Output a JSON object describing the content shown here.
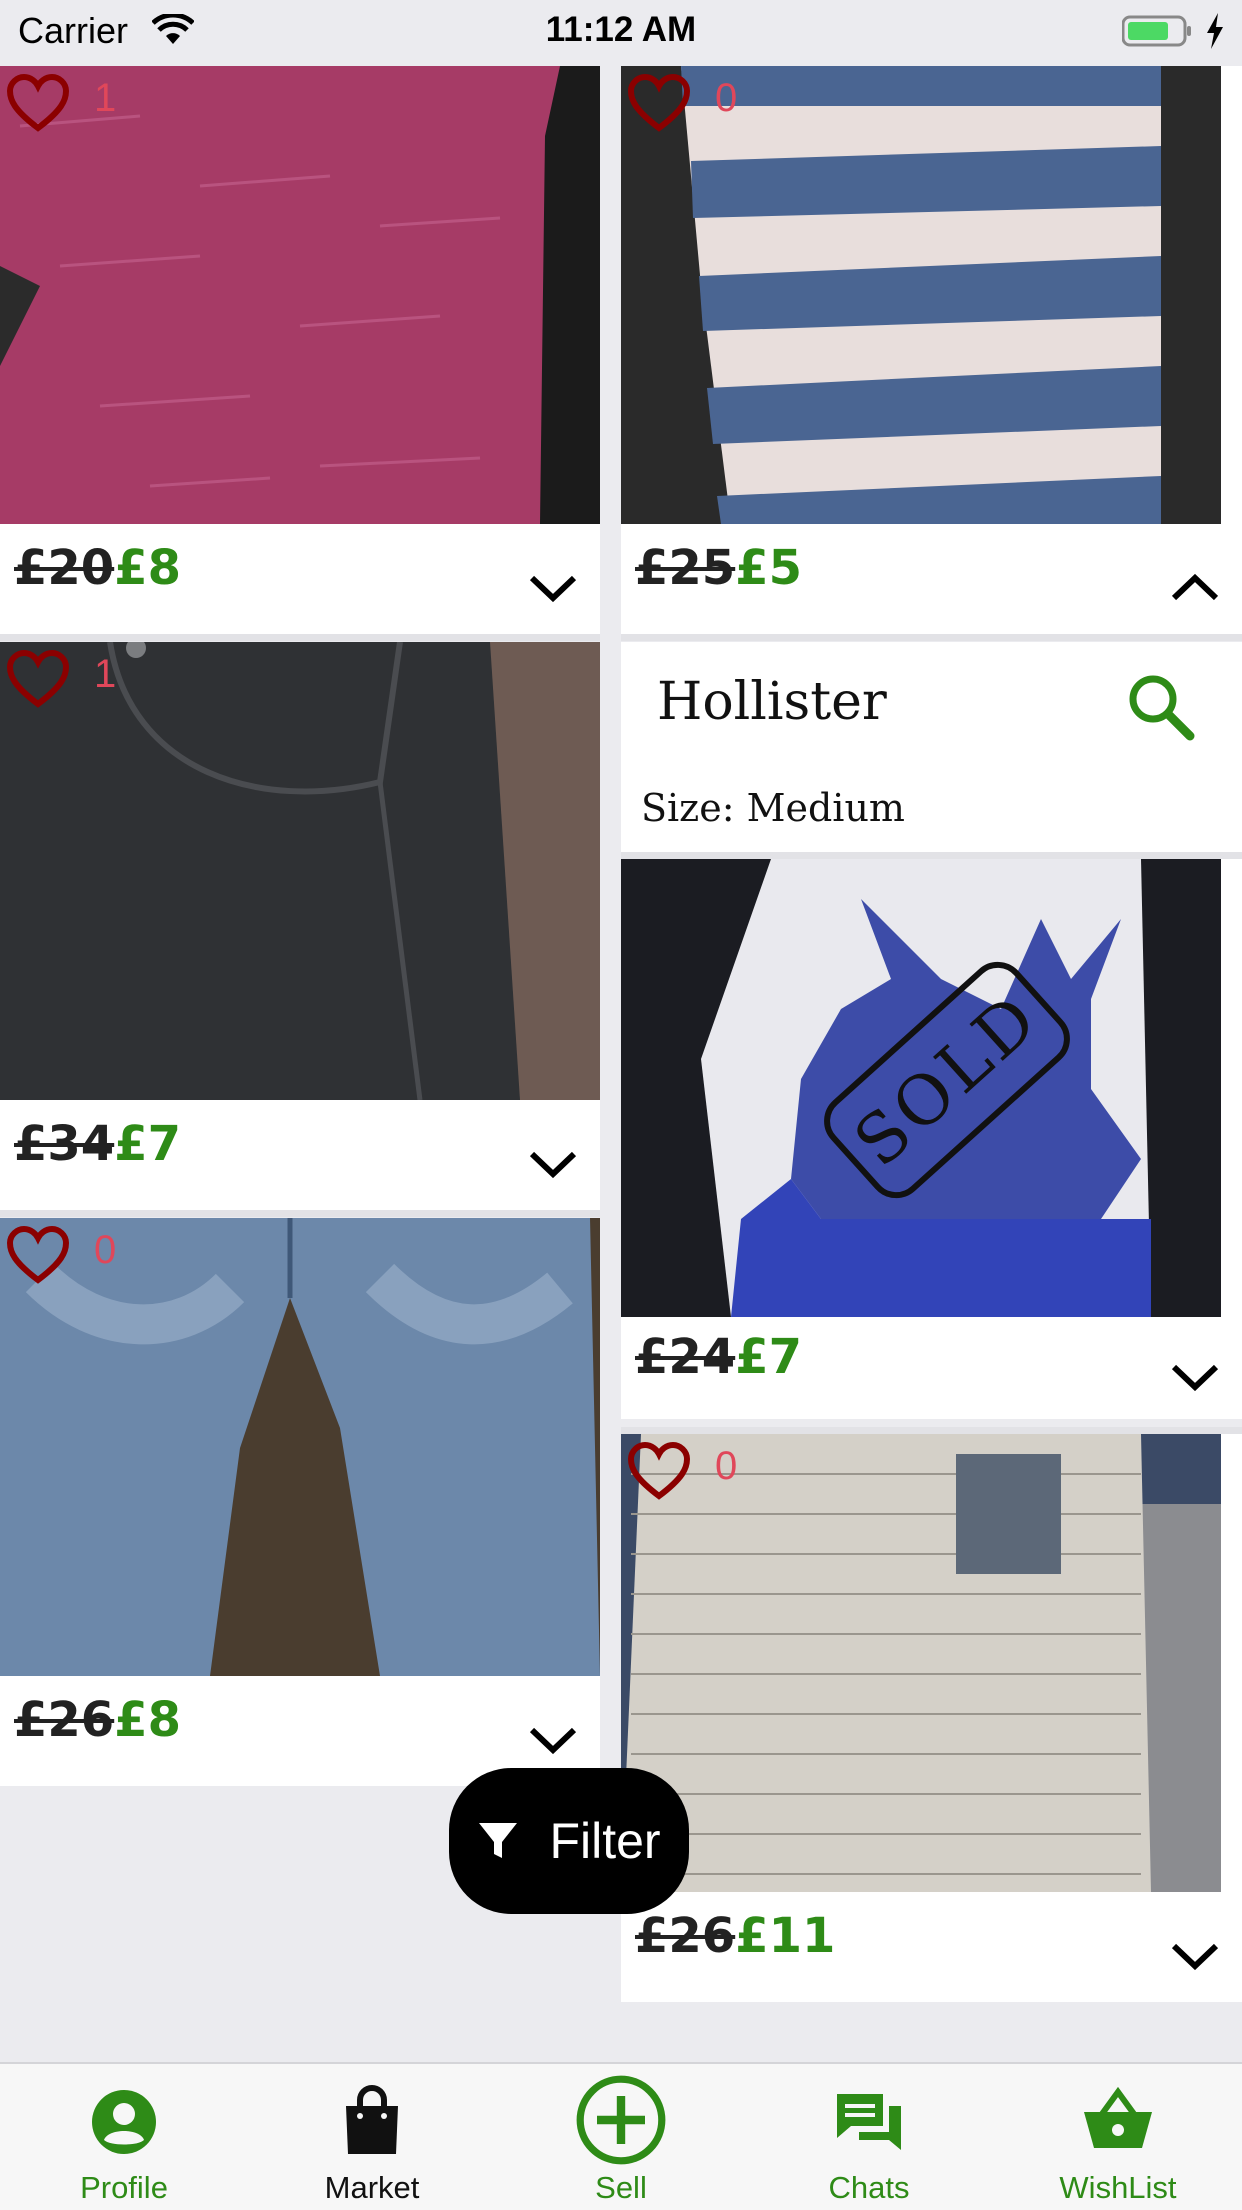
{
  "status_bar": {
    "carrier": "Carrier",
    "time": "11:12 AM"
  },
  "colors": {
    "accent": "#2e8b17",
    "heart": "#8b0000",
    "likes": "#e0475a",
    "background": "#ebebef"
  },
  "items": [
    {
      "likes": "1",
      "old_price": "£20",
      "new_price": "£8",
      "expanded": false,
      "photo": "pink t-shirt"
    },
    {
      "likes": "0",
      "old_price": "£25",
      "new_price": "£5",
      "expanded": true,
      "photo": "blue and white striped t-shirt"
    },
    {
      "likes": "1",
      "old_price": "£34",
      "new_price": "£7",
      "expanded": false,
      "photo": "dark jeans"
    },
    {
      "likes": "0",
      "old_price": "£26",
      "new_price": "£8",
      "expanded": false,
      "photo": "light washed jeans"
    },
    {
      "old_price": "£24",
      "new_price": "£7",
      "expanded": false,
      "photo": "stag print t-shirt",
      "sold_label": "SOLD"
    },
    {
      "likes": "0",
      "old_price": "£26",
      "new_price": "£11",
      "expanded": false,
      "photo": "grey striped t-shirt"
    }
  ],
  "detail": {
    "brand": "Hollister",
    "size": "Size: Medium"
  },
  "filter": {
    "label": "Filter"
  },
  "tabs": [
    {
      "label": "Profile",
      "icon": "profile-icon",
      "active": false
    },
    {
      "label": "Market",
      "icon": "shopping-bag-icon",
      "active": true
    },
    {
      "label": "Sell",
      "icon": "plus-circle-icon",
      "active": false
    },
    {
      "label": "Chats",
      "icon": "chat-icon",
      "active": false
    },
    {
      "label": "WishList",
      "icon": "basket-icon",
      "active": false
    }
  ]
}
